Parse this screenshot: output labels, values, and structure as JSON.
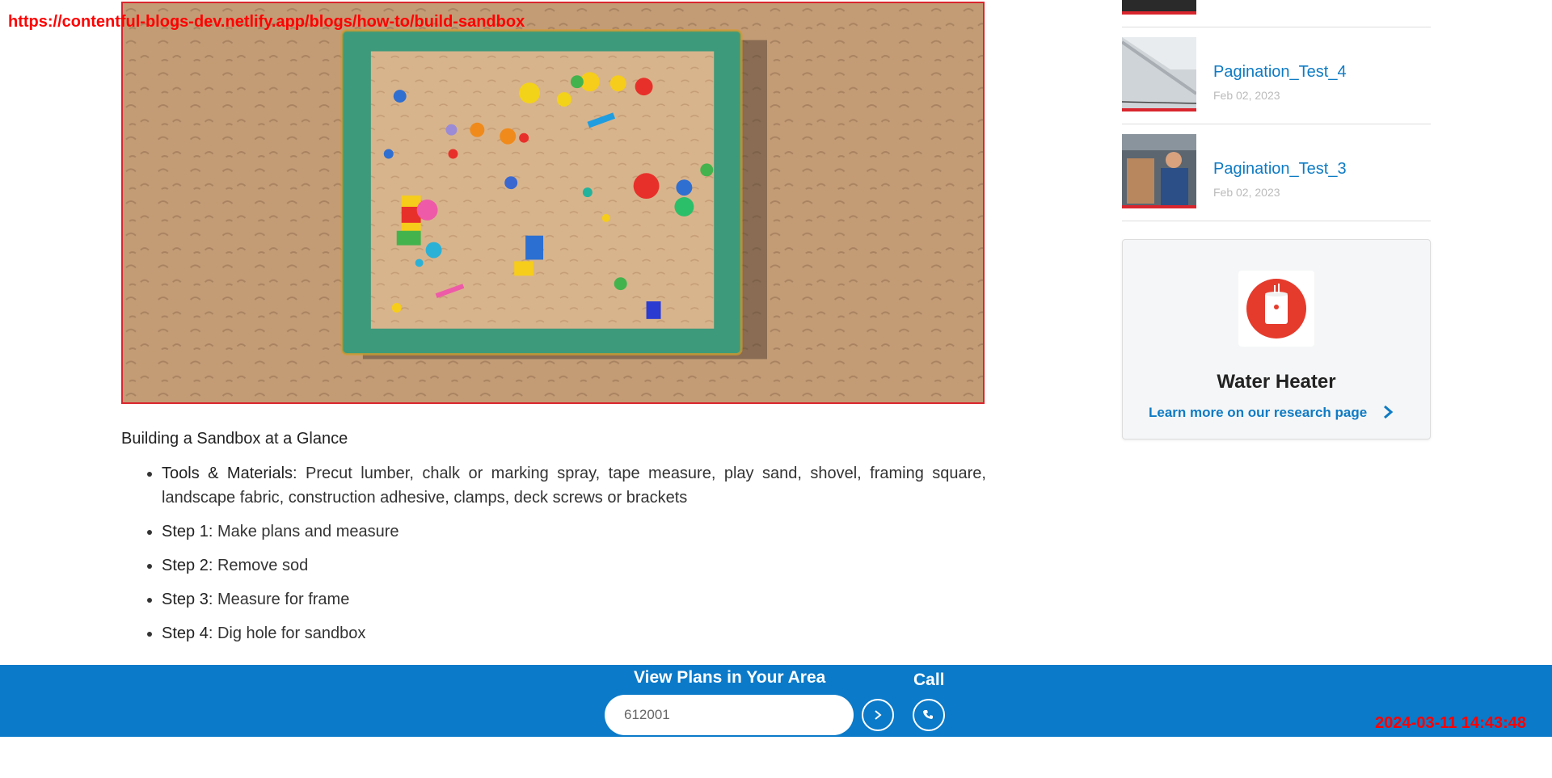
{
  "url": "https://contentful-blogs-dev.netlify.app/blogs/how-to/build-sandbox",
  "timestamp": "2024-03-11 14:43:48",
  "hero_image": {
    "alt": "sandbox-photo"
  },
  "article": {
    "heading": "Building a Sandbox at a Glance",
    "items": [
      {
        "label": "Tools & Materials",
        "text": ": Precut lumber, chalk or marking spray, tape measure, play sand, shovel, framing square, landscape fabric, construction adhesive, clamps, deck screws or brackets"
      },
      {
        "label": "Step 1",
        "text": ": Make plans and measure"
      },
      {
        "label": "Step 2",
        "text": ": Remove sod"
      },
      {
        "label": "Step 3",
        "text": ": Measure for frame"
      },
      {
        "label": "Step 4",
        "text": ": Dig hole for sandbox"
      }
    ]
  },
  "sidebar": {
    "posts": [
      {
        "title": "Pagination_Test_4",
        "date": "Feb 02, 2023"
      },
      {
        "title": "Pagination_Test_3",
        "date": "Feb 02, 2023"
      }
    ],
    "card": {
      "title": "Water Heater",
      "link": "Learn more on our research page",
      "icon": "water-heater-icon"
    }
  },
  "bottom_bar": {
    "title": "View Plans in Your Area",
    "zip_value": "612001",
    "call_label": "Call",
    "background": "#0a7ac9"
  },
  "colors": {
    "accent": "#0e7bc4",
    "brand_red": "#d9262e"
  }
}
